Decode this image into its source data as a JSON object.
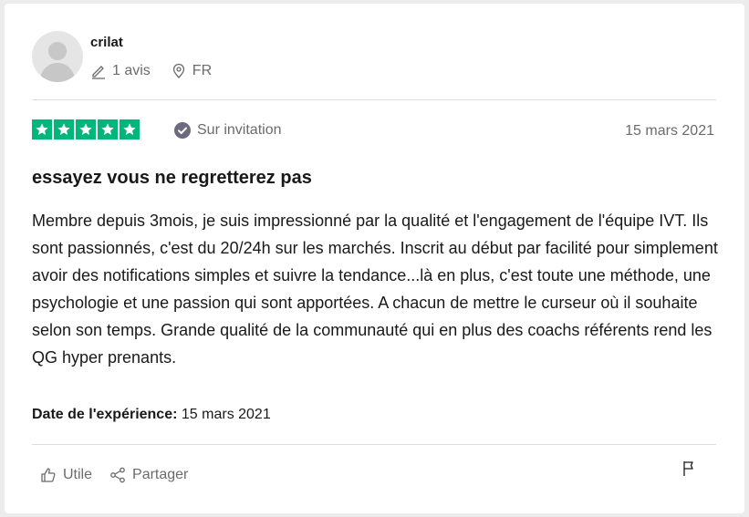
{
  "reviewer": {
    "name": "crilat",
    "reviews_count": "1 avis",
    "country": "FR"
  },
  "review": {
    "rating": 5,
    "rating_color": "#00b67a",
    "invitation_label": "Sur invitation",
    "date": "15 mars 2021",
    "title": "essayez vous ne regretterez pas",
    "body": "Membre depuis 3mois, je suis impressionné par la qualité et l'engagement de l'équipe IVT. Ils sont passionnés, c'est du 20/24h sur les marchés. Inscrit au début par facilité pour simplement avoir des notifications simples et suivre la tendance...là en plus, c'est toute une méthode, une psychologie et une passion qui sont apportées. A chacun de mettre le curseur où il souhaite selon son temps. Grande qualité de la communauté qui en plus des coachs référents rend les QG hyper prenants.",
    "experience_label": "Date de l'expérience:",
    "experience_date": "15 mars 2021"
  },
  "actions": {
    "useful_label": "Utile",
    "share_label": "Partager"
  },
  "icons": [
    "avatar-placeholder-icon",
    "pencil-icon",
    "location-pin-icon",
    "star-icon",
    "verified-check-icon",
    "thumbs-up-icon",
    "share-icon",
    "flag-icon"
  ]
}
